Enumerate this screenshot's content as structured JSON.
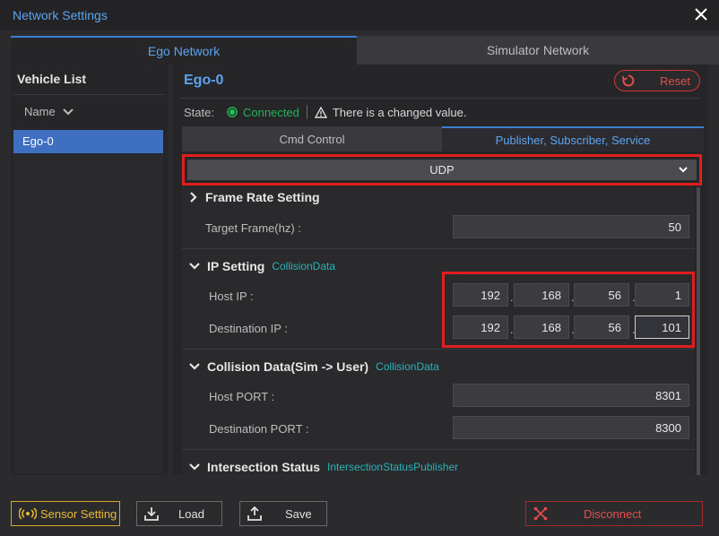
{
  "window": {
    "title": "Network Settings"
  },
  "top_tabs": [
    {
      "label": "Ego Network",
      "active": true
    },
    {
      "label": "Simulator Network",
      "active": false
    }
  ],
  "vehicle_list": {
    "title": "Vehicle List",
    "sort_label": "Name",
    "items": [
      {
        "label": "Ego-0",
        "selected": true
      }
    ]
  },
  "detail": {
    "title": "Ego-0",
    "reset_label": "Reset",
    "state_label": "State:",
    "state_value": "Connected",
    "state_message": "There is a changed value.",
    "sub_tabs": [
      {
        "label": "Cmd Control",
        "active": false
      },
      {
        "label": "Publisher, Subscriber, Service",
        "active": true
      }
    ],
    "protocol": "UDP",
    "sections": {
      "frame_rate": {
        "title": "Frame Rate Setting",
        "target_label": "Target Frame(hz) :",
        "target_value": "50"
      },
      "ip_setting": {
        "title": "IP Setting",
        "tag": "CollisionData",
        "host_label": "Host IP :",
        "host_ip": [
          "192",
          "168",
          "56",
          "1"
        ],
        "dest_label": "Destination IP :",
        "dest_ip": [
          "192",
          "168",
          "56",
          "101"
        ]
      },
      "collision": {
        "title": "Collision Data(Sim -> User)",
        "tag": "CollisionData",
        "host_port_label": "Host PORT :",
        "host_port": "8301",
        "dest_port_label": "Destination PORT :",
        "dest_port": "8300"
      },
      "intersection": {
        "title": "Intersection Status",
        "tag": "IntersectionStatusPublisher"
      }
    }
  },
  "bottom": {
    "sensor_label": "Sensor Setting",
    "load_label": "Load",
    "save_label": "Save",
    "disconnect_label": "Disconnect"
  },
  "colors": {
    "accent": "#5ba4ef",
    "highlight_border": "#e01e1e",
    "connected": "#22b354",
    "tag": "#27b3b8",
    "danger": "#e44d4d",
    "sensor": "#e8b934"
  },
  "icons": [
    "close-icon",
    "chevron-down-icon",
    "reset-icon",
    "status-dot-icon",
    "warning-icon",
    "chevron-right-icon",
    "sensor-icon",
    "load-icon",
    "save-icon",
    "disconnect-icon"
  ]
}
